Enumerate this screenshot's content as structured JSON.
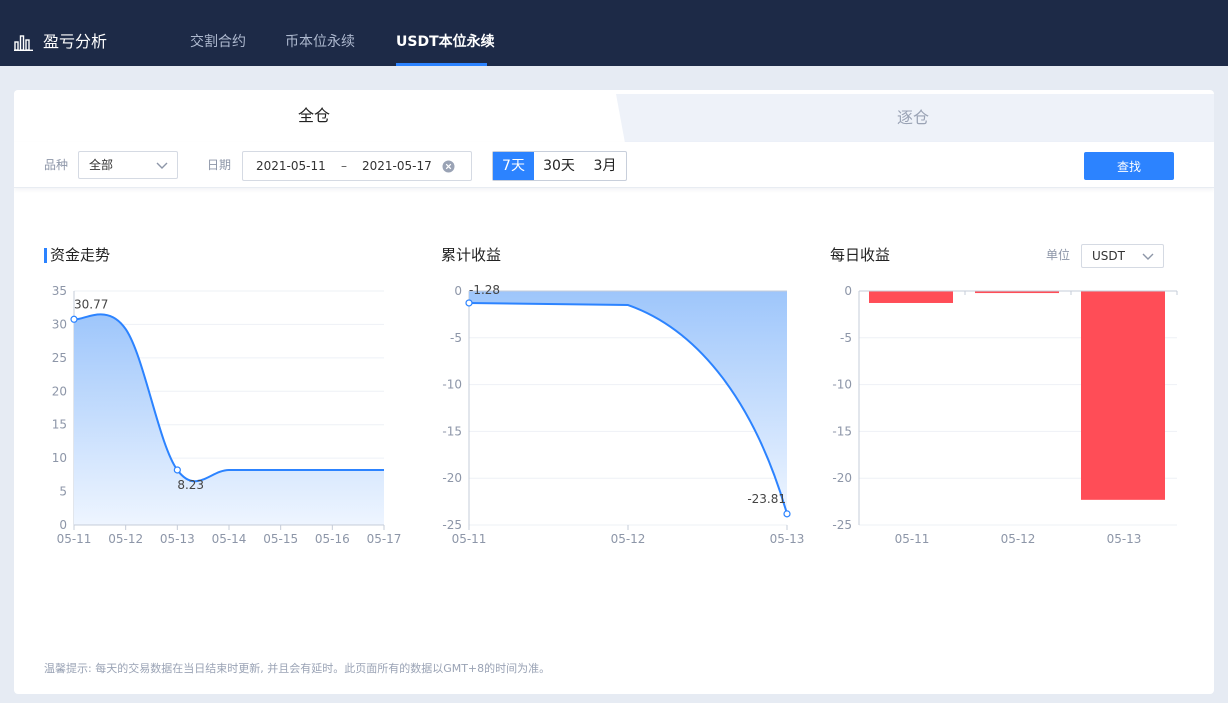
{
  "header": {
    "title": "盈亏分析",
    "tabs": [
      {
        "label": "交割合约",
        "active": false
      },
      {
        "label": "币本位永续",
        "active": false
      },
      {
        "label": "USDT本位永续",
        "active": true
      }
    ]
  },
  "margin_tabs": [
    {
      "label": "全仓",
      "active": true
    },
    {
      "label": "逐仓",
      "active": false
    }
  ],
  "filters": {
    "symbol_label": "品种",
    "symbol_value": "全部",
    "date_label": "日期",
    "date_start": "2021-05-11",
    "date_separator": "–",
    "date_end": "2021-05-17",
    "ranges": [
      {
        "label": "7天",
        "active": true
      },
      {
        "label": "30天",
        "active": false
      },
      {
        "label": "3月",
        "active": false
      }
    ],
    "search_label": "查找"
  },
  "unit": {
    "label": "单位",
    "value": "USDT"
  },
  "colors": {
    "accent": "#2c83ff",
    "negative": "#ff4d57",
    "header_bg": "#1d2a47"
  },
  "chart_data": [
    {
      "type": "area",
      "title": "资金走势",
      "x": [
        "05-11",
        "05-12",
        "05-13",
        "05-14",
        "05-15",
        "05-16",
        "05-17"
      ],
      "values": [
        30.77,
        29.3,
        8.23,
        8.23,
        8.23,
        8.23,
        8.23
      ],
      "labels": [
        {
          "x": "05-11",
          "text": "30.77"
        },
        {
          "x": "05-13",
          "text": "8.23"
        }
      ],
      "yticks": [
        "0",
        "5",
        "10",
        "15",
        "20",
        "25",
        "30",
        "35"
      ],
      "ylim": [
        0,
        35
      ],
      "grid": true
    },
    {
      "type": "area",
      "title": "累计收益",
      "x": [
        "05-11",
        "05-12",
        "05-13"
      ],
      "values": [
        -1.28,
        -1.5,
        -23.81
      ],
      "labels": [
        {
          "x": "05-11",
          "text": "-1.28"
        },
        {
          "x": "05-13",
          "text": "-23.81"
        }
      ],
      "yticks": [
        "-25",
        "-20",
        "-15",
        "-10",
        "-5",
        "0"
      ],
      "ylim": [
        -25,
        0
      ],
      "grid": true
    },
    {
      "type": "bar",
      "title": "每日收益",
      "categories": [
        "05-11",
        "05-12",
        "05-13"
      ],
      "values": [
        -1.28,
        -0.22,
        -22.31
      ],
      "yticks": [
        "-25",
        "-20",
        "-15",
        "-10",
        "-5",
        "0"
      ],
      "ylim": [
        -25,
        0
      ],
      "grid": true
    }
  ],
  "footnote": "温馨提示: 每天的交易数据在当日结束时更新, 并且会有延时。此页面所有的数据以GMT+8的时间为准。"
}
